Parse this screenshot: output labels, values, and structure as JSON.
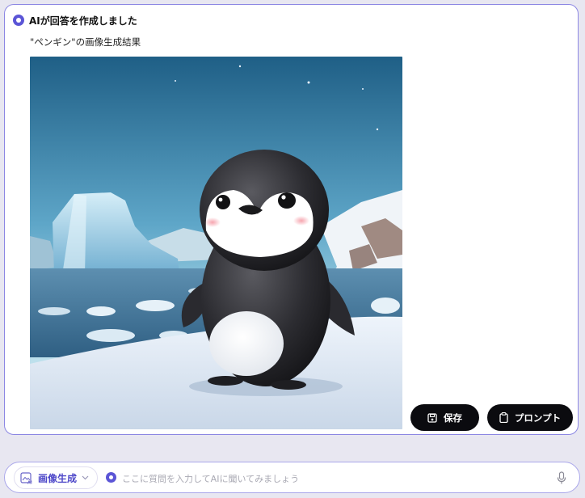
{
  "response": {
    "status": "AIが回答を作成しました",
    "caption": "\"ペンギン\"の画像生成結果",
    "image_alt": "ペンギン"
  },
  "actions": {
    "save_label": "保存",
    "prompt_label": "プロンプト"
  },
  "input": {
    "mode_label": "画像生成",
    "placeholder": "ここに質問を入力してAIに聞いてみましょう",
    "value": ""
  },
  "icons": {
    "status": "ai-dot-icon",
    "save": "floppy-disk-icon",
    "prompt": "clipboard-icon",
    "mode": "ai-image-icon",
    "mode_dropdown": "chevron-down-icon",
    "mic": "microphone-icon"
  },
  "colors": {
    "accent": "#5b55d6",
    "button_bg": "#0b0b0f",
    "page_bg": "#e8e7f1",
    "card_border": "#8b86e3"
  }
}
